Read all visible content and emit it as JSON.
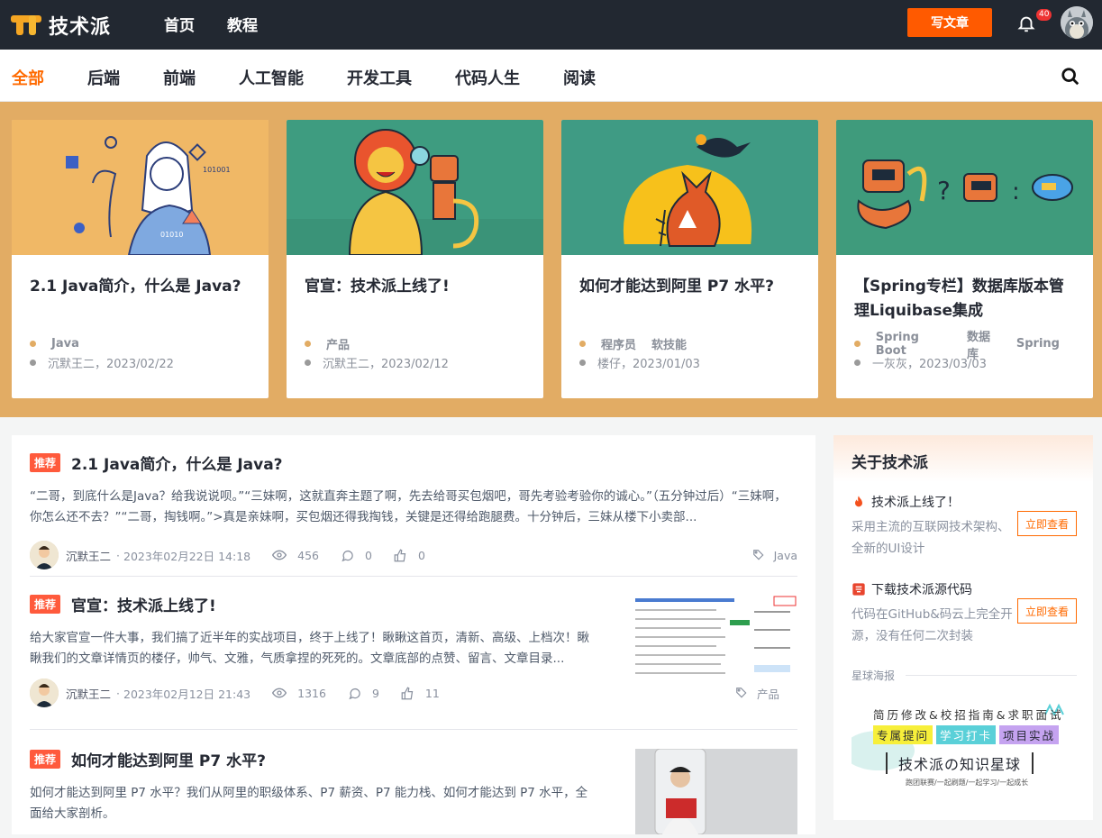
{
  "header": {
    "logo_text": "技术派",
    "nav": [
      "首页",
      "教程"
    ],
    "write_button": "写文章",
    "notification_count": "40"
  },
  "categories": [
    "全部",
    "后端",
    "前端",
    "人工智能",
    "开发工具",
    "代码人生",
    "阅读"
  ],
  "active_category": "全部",
  "banner": {
    "background": "#e2ac64",
    "cards": [
      {
        "title": "2.1 Java简介，什么是 Java?",
        "tags": [
          "Java"
        ],
        "author": "沉默王二，2023/02/22",
        "image": "woman-with-security-icons-illustration",
        "image_bg": "#efb464"
      },
      {
        "title": "官宣：技术派上线了!",
        "tags": [
          "产品"
        ],
        "author": "沉默王二，2023/02/12",
        "image": "lion-and-robot-illustration",
        "image_bg": "#3c9a80"
      },
      {
        "title": "如何才能达到阿里 P7 水平?",
        "tags": [
          "程序员",
          "软技能"
        ],
        "author": "楼仔，2023/01/03",
        "image": "fox-and-crow-illustration",
        "image_bg": "#3e9a84"
      },
      {
        "title": "【Spring专栏】数据库版本管理Liquibase集成",
        "tags": [
          "Spring Boot",
          "数据库",
          "Spring"
        ],
        "author": "一灰灰，2023/03/03",
        "image": "robot-question-illustration",
        "image_bg": "#3f9a7c"
      }
    ]
  },
  "articles": [
    {
      "badge": "推荐",
      "title": "2.1 Java简介，什么是 Java?",
      "summary": "“二哥，到底什么是Java？给我说说呗。”“三妹啊，这就直奔主题了啊，先去给哥买包烟吧，哥先考验考验你的诚心。”（五分钟过后）“三妹啊，你怎么还不去？”“二哥，掏钱啊。”>真是亲妹啊，买包烟还得我掏钱，关键是还得给跑腿费。十分钟后，三妹从楼下小卖部...",
      "author": "沉默王二",
      "date": "2023年02月22日 14:18",
      "views": "456",
      "comments": "0",
      "likes": "0",
      "tag": "Java"
    },
    {
      "badge": "推荐",
      "title": "官宣：技术派上线了!",
      "summary": "给大家官宣一件大事，我们搞了近半年的实战项目，终于上线了！瞅瞅这首页，清新、高级、上档次！瞅瞅我们的文章详情页的楼仔，帅气、文雅，气质拿捏的死死的。文章底部的点赞、留言、文章目录...",
      "author": "沉默王二",
      "date": "2023年02月12日 21:43",
      "views": "1316",
      "comments": "9",
      "likes": "11",
      "tag": "产品"
    },
    {
      "badge": "推荐",
      "title": "如何才能达到阿里 P7 水平?",
      "summary": "如何才能达到阿里 P7 水平？我们从阿里的职级体系、P7 薪资、P7 能力栈、如何才能达到 P7 水平，全面给大家剖析。"
    }
  ],
  "sidebar": {
    "title": "关于技术派",
    "items": [
      {
        "title": "技术派上线了！",
        "desc": "采用主流的互联网技术架构、全新的UI设计",
        "button": "立即查看",
        "icon": "fire-icon"
      },
      {
        "title": "下载技术派源代码",
        "desc": "代码在GitHub&码云上完全开源，没有任何二次封装",
        "button": "立即查看",
        "icon": "code-icon"
      }
    ],
    "poster_label": "星球海报",
    "poster": {
      "line1": "简历修改&校招指南&求职面试",
      "chips": [
        "专属提问",
        "学习打卡",
        "项目实战"
      ],
      "title": "技术派の知识星球",
      "sub": "跑团联赛/一起刷题/一起学习/一起成长"
    }
  }
}
